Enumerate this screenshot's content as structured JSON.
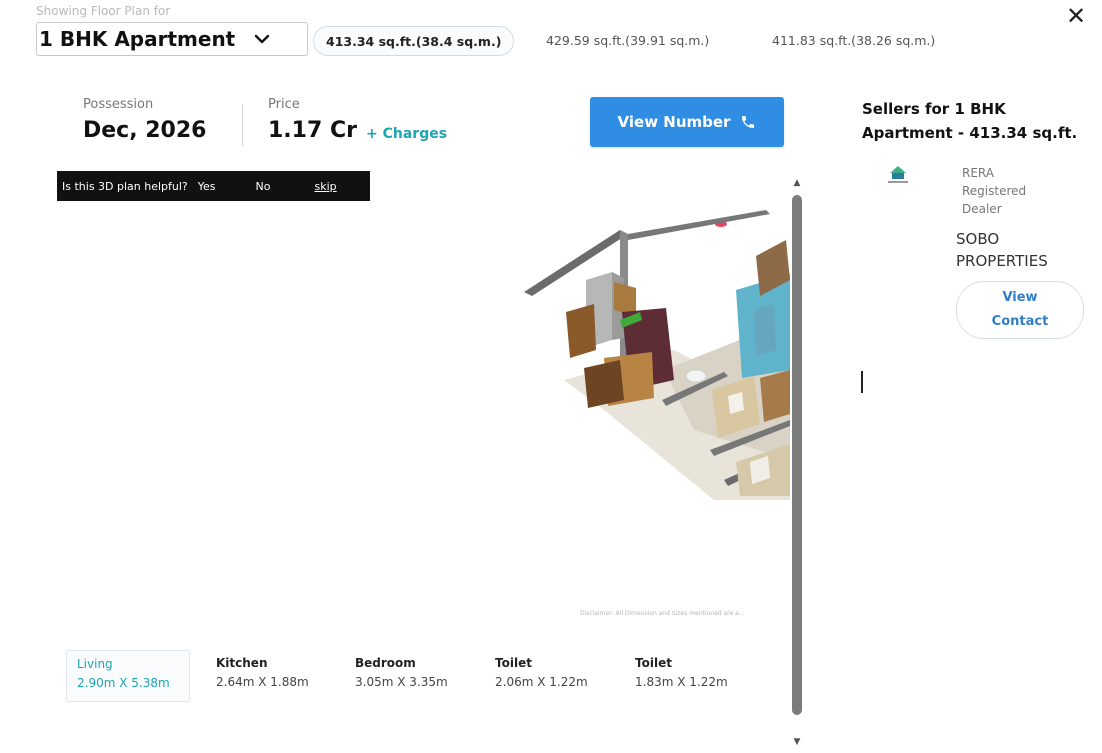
{
  "header": {
    "showing_label": "Showing Floor Plan for",
    "config_selected": "1 BHK Apartment",
    "areas": [
      {
        "label": "413.34 sq.ft.(38.4 sq.m.)",
        "active": true
      },
      {
        "label": "429.59 sq.ft.(39.91 sq.m.)",
        "active": false
      },
      {
        "label": "411.83 sq.ft.(38.26 sq.m.)",
        "active": false
      }
    ],
    "close_symbol": "✕"
  },
  "info": {
    "possession_label": "Possession",
    "possession_value": "Dec, 2026",
    "price_label": "Price",
    "price_value": "1.17 Cr",
    "charges_link": "+ Charges",
    "view_number_label": "View Number"
  },
  "feedback": {
    "question": "Is this 3D plan helpful?",
    "yes": "Yes",
    "no": "No",
    "skip": "skip"
  },
  "plan": {
    "disclaimer": "Disclaimer: All Dimension and Sizes mentioned are a..."
  },
  "rooms": [
    {
      "name": "Living",
      "dims": "2.90m X 5.38m",
      "active": true
    },
    {
      "name": "Kitchen",
      "dims": "2.64m X 1.88m",
      "active": false
    },
    {
      "name": "Bedroom",
      "dims": "3.05m X 3.35m",
      "active": false
    },
    {
      "name": "Toilet",
      "dims": "2.06m X 1.22m",
      "active": false
    },
    {
      "name": "Toilet",
      "dims": "1.83m X 1.22m",
      "active": false
    }
  ],
  "sellers": {
    "title_line1": "Sellers for 1 BHK",
    "title_line2": "Apartment - 413.34 sq.ft.",
    "rera_line1": "RERA",
    "rera_line2": "Registered",
    "rera_line3": "Dealer",
    "dealer_line1": "SOBO",
    "dealer_line2": "PROPERTIES",
    "view_contact_line1": "View",
    "view_contact_line2": "Contact"
  },
  "colors": {
    "primary_button": "#2f8de4",
    "accent_teal": "#19a6b5",
    "link_blue": "#2f7fc8"
  },
  "icons": [
    "chevron-down-icon",
    "close-icon",
    "phone-icon",
    "scroll-up-arrow-icon",
    "scroll-down-arrow-icon",
    "dealer-logo-icon"
  ]
}
